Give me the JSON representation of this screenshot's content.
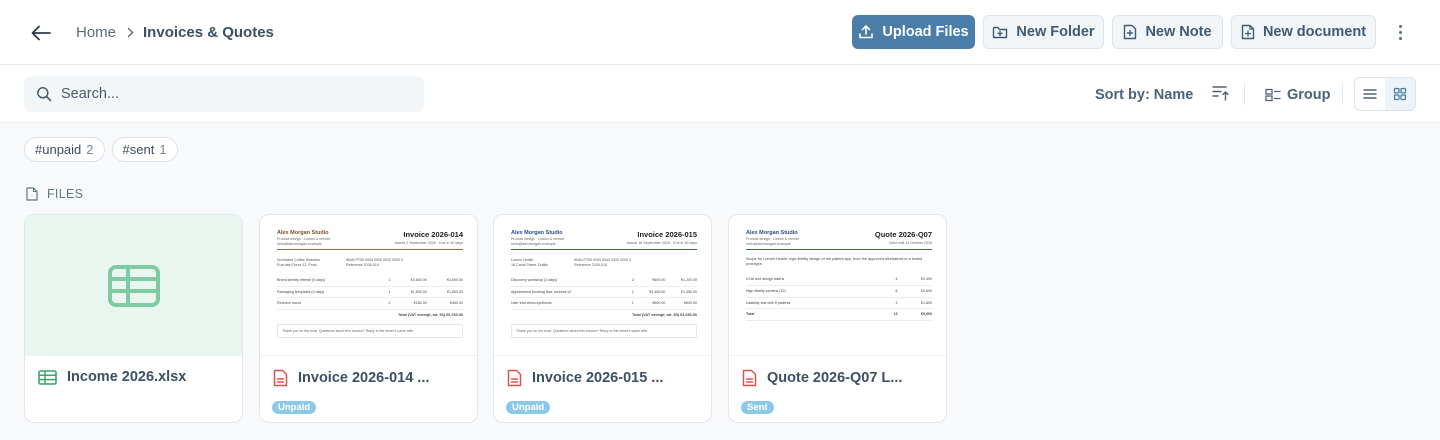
{
  "header": {
    "breadcrumb": {
      "home": "Home",
      "current": "Invoices & Quotes"
    },
    "buttons": {
      "upload": "Upload Files",
      "new_folder": "New Folder",
      "new_note": "New Note",
      "new_document": "New document"
    }
  },
  "toolbar": {
    "search_placeholder": "Search...",
    "sort_label": "Sort by: Name",
    "group_label": "Group",
    "view": "grid"
  },
  "tags": [
    {
      "label": "#unpaid",
      "count": "2"
    },
    {
      "label": "#sent",
      "count": "1"
    }
  ],
  "section": {
    "title": "FILES"
  },
  "files": [
    {
      "name": "Income 2026.xlsx",
      "kind": "spreadsheet",
      "icon": "spreadsheet-icon",
      "badge": ""
    },
    {
      "name": "Invoice 2026-014 ...",
      "kind": "pdf",
      "icon": "pdf-icon",
      "badge": "Unpaid"
    },
    {
      "name": "Invoice 2026-015 ...",
      "kind": "pdf",
      "icon": "pdf-icon",
      "badge": "Unpaid"
    },
    {
      "name": "Quote 2026-Q07 L...",
      "kind": "pdf",
      "icon": "pdf-icon",
      "badge": "Sent"
    }
  ],
  "previews": {
    "inv014": {
      "studio": "Alex Morgan Studio",
      "sub1": "Product design · Lisbon & remote",
      "sub2": "hello@alexmorgan.example",
      "title": "Invoice 2026-014",
      "date": "Issued 2 September 2026 · Due in 30 days",
      "billto": "Northwind Coffee Roasters",
      "billto2": "Rua das Flores 12, Porto",
      "payment": "IBAN PT50 0000 0000 0000 0000 0",
      "payment2": "Reference 2026-014",
      "rows": [
        [
          "Brand identity refresh (6 days)",
          "1",
          "€3,600.00",
          "€3,600.00"
        ],
        [
          "Packaging templates (3 days)",
          "1",
          "€1,800.00",
          "€1,800.00"
        ],
        [
          "Revision round",
          "2",
          "€180.00",
          "€360.00"
        ]
      ],
      "total": "Total (VAT exempt, art. 53)  €5,760.00",
      "note": "Thank you for the trust. Questions about this invoice? Reply to the email it came with."
    },
    "inv015": {
      "studio": "Alex Morgan Studio",
      "sub1": "Product design · Lisbon & remote",
      "sub2": "hello@alexmorgan.example",
      "title": "Invoice 2026-015",
      "date": "Issued 18 September 2026 · Due in 30 days",
      "billto": "Lumen Health",
      "billto2": "18 Canal Street, Dublin",
      "payment": "IBAN PT50 0000 0000 0000 0000 0",
      "payment2": "Reference 2026-015",
      "rows": [
        [
          "Discovery workshop (2 days)",
          "2",
          "€600.00",
          "€1,200.00"
        ],
        [
          "Appointment booking flow, screens v2",
          "1",
          "€1,450.00",
          "€1,450.00"
        ],
        [
          "User interviews synthesis",
          "1",
          "€600.00",
          "€600.00"
        ]
      ],
      "total": "Total (VAT exempt, art. 53)  €3,250.00",
      "note": "Thank you for the trust. Questions about this invoice? Reply to the email it came with."
    },
    "q07": {
      "studio": "Alex Morgan Studio",
      "sub1": "Product design · Lisbon & remote",
      "sub2": "hello@alexmorgan.example",
      "title": "Quote 2026-Q07",
      "date": "Valid until 31 October 2026",
      "intro": "Scope for Lumen Health: high-fidelity design of the patient app, from the approved wireframes to a tested prototype.",
      "rows": [
        [
          "UI kit and design tokens",
          "4",
          "€2,400"
        ],
        [
          "High-fidelity screens (32)",
          "6",
          "€3,600"
        ],
        [
          "Usability test with 5 patients",
          "3",
          "€1,800"
        ],
        [
          "Total",
          "13",
          "€9,000"
        ]
      ]
    }
  }
}
